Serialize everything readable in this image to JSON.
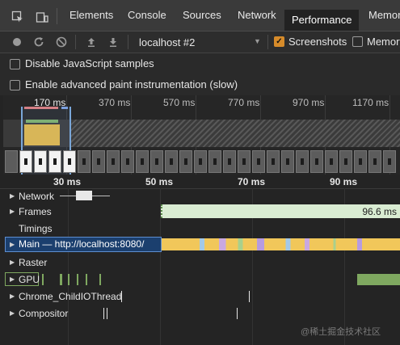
{
  "tabs": [
    {
      "label": "Elements"
    },
    {
      "label": "Console"
    },
    {
      "label": "Sources"
    },
    {
      "label": "Network"
    },
    {
      "label": "Performance"
    },
    {
      "label": "Memor"
    }
  ],
  "toolbar": {
    "profile_select": "localhost #2",
    "screenshots_label": "Screenshots",
    "screenshots_checked": true,
    "memory_label": "Memory"
  },
  "settings": {
    "disable_js_samples": "Disable JavaScript samples",
    "advanced_paint": "Enable advanced paint instrumentation (slow)"
  },
  "overview": {
    "ticks": [
      "170 ms",
      "370 ms",
      "570 ms",
      "770 ms",
      "970 ms",
      "1170 ms"
    ]
  },
  "ruler": {
    "ticks": [
      "30 ms",
      "50 ms",
      "70 ms",
      "90 ms"
    ]
  },
  "tracks": {
    "network": "Network",
    "frames": "Frames",
    "frames_duration": "96.6 ms",
    "timings": "Timings",
    "main": "Main — http://localhost:8080/",
    "raster": "Raster",
    "gpu": "GPU",
    "child_io": "Chrome_ChildIOThread",
    "compositor": "Compositor"
  },
  "watermark": "@稀土掘金技术社区",
  "colors": {
    "accent": "#d68b2a",
    "frames": "#d9ecd2",
    "main_selected": "#1b3f6e",
    "scripting": "#f1c75a",
    "gpu": "#7fa860"
  }
}
